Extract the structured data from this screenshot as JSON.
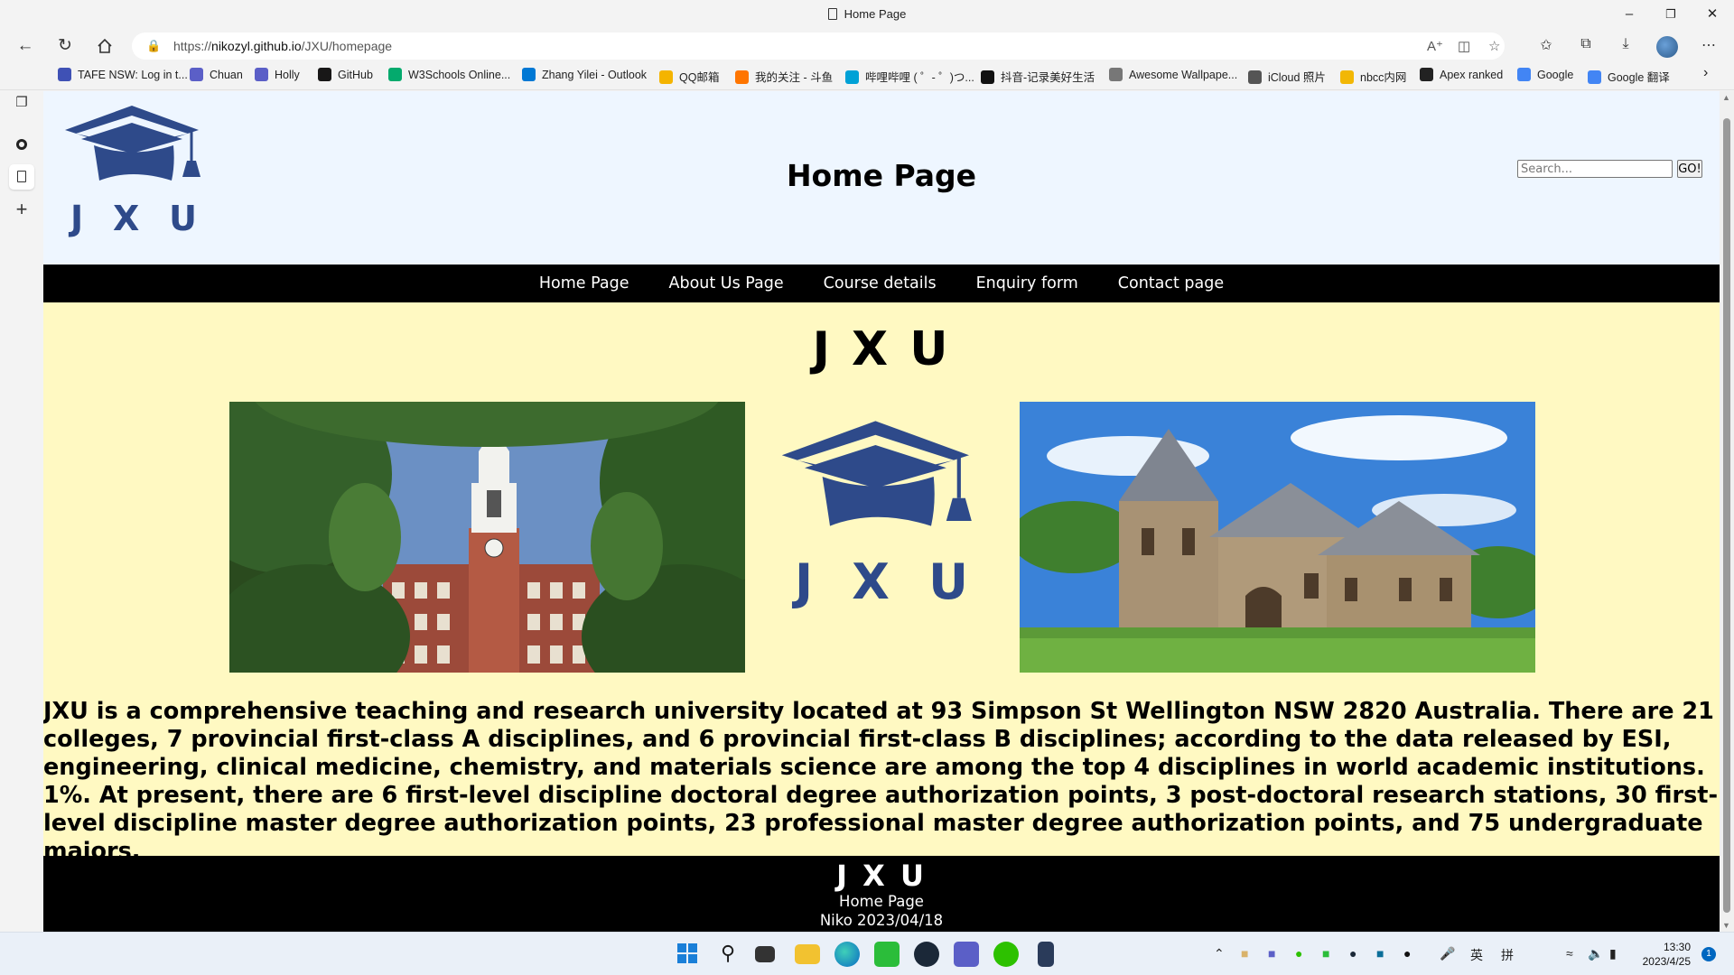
{
  "browser": {
    "tab_title": "Home Page",
    "url_prefix": "https://",
    "url_host": "nikozyl.github.io",
    "url_path": "/JXU/homepage",
    "bookmarks": [
      {
        "label": "TAFE NSW: Log in t...",
        "icon": "tafe-icon",
        "color": "#3f51b5"
      },
      {
        "label": "Chuan",
        "icon": "teams-icon",
        "color": "#5b5fc7"
      },
      {
        "label": "Holly",
        "icon": "teams-icon",
        "color": "#5b5fc7"
      },
      {
        "label": "GitHub",
        "icon": "github-icon",
        "color": "#181717"
      },
      {
        "label": "W3Schools Online...",
        "icon": "w3schools-icon",
        "color": "#04aa6d"
      },
      {
        "label": "Zhang Yilei - Outlook",
        "icon": "outlook-icon",
        "color": "#0078d4"
      },
      {
        "label": "QQ邮箱",
        "icon": "qq-mail-icon",
        "color": "#f4b400"
      },
      {
        "label": "我的关注 - 斗鱼",
        "icon": "douyu-icon",
        "color": "#ff7500"
      },
      {
        "label": "哔哩哔哩 ( ゜- ゜)つ...",
        "icon": "bilibili-icon",
        "color": "#00a1d6"
      },
      {
        "label": "抖音-记录美好生活",
        "icon": "douyin-icon",
        "color": "#111111"
      },
      {
        "label": "Awesome Wallpape...",
        "icon": "wallpaper-icon",
        "color": "#777777"
      },
      {
        "label": "iCloud 照片",
        "icon": "apple-icon",
        "color": "#555555"
      },
      {
        "label": "nbcc内网",
        "icon": "lock-icon",
        "color": "#f2b705"
      },
      {
        "label": "Apex ranked",
        "icon": "apex-icon",
        "color": "#222222"
      },
      {
        "label": "Google",
        "icon": "google-icon",
        "color": "#4285f4"
      },
      {
        "label": "Google 翻译",
        "icon": "google-translate-icon",
        "color": "#4285f4"
      }
    ]
  },
  "site": {
    "logo_letters": [
      "J",
      "X",
      "U"
    ],
    "header_title": "Home Page",
    "search_placeholder": "Search...",
    "search_button": "GO!",
    "nav": [
      "Home Page",
      "About Us Page",
      "Course details",
      "Enquiry form",
      "Contact page"
    ],
    "main_title": "J X U",
    "description": "JXU is a comprehensive teaching and research university located at 93 Simpson St Wellington NSW 2820 Australia. There are 21 colleges, 7 provincial first-class A disciplines, and 6 provincial first-class B disciplines; according to the data released by ESI, engineering, clinical medicine, chemistry, and materials science are among the top 4 disciplines in world academic institutions. 1%. At present, there are 6 first-level discipline doctoral degree authorization points, 3 post-doctoral research stations, 30 first-level discipline master degree authorization points, 23 professional master degree authorization points, and 75 undergraduate majors.",
    "footer_title": "J X U",
    "footer_page": "Home Page",
    "footer_credit": "Niko 2023/04/18",
    "brand_color": "#2e4a8a",
    "main_bg": "#fff9c2",
    "header_bg": "#eef6ff"
  },
  "taskbar": {
    "clock_time": "13:30",
    "clock_date": "2023/4/25",
    "ime_lang": "英",
    "ime_mode": "拼",
    "notification_count": "1"
  }
}
